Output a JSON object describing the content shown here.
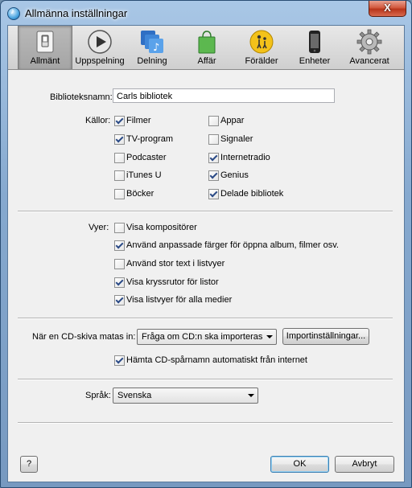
{
  "window": {
    "title": "Allmänna inställningar",
    "close_label": "X"
  },
  "toolbar": {
    "items": [
      {
        "label": "Allmänt",
        "icon": "general-switch-icon",
        "active": true
      },
      {
        "label": "Uppspelning",
        "icon": "play-icon"
      },
      {
        "label": "Delning",
        "icon": "sharing-icon"
      },
      {
        "label": "Affär",
        "icon": "store-bag-icon"
      },
      {
        "label": "Förälder",
        "icon": "parental-icon"
      },
      {
        "label": "Enheter",
        "icon": "device-icon"
      },
      {
        "label": "Avancerat",
        "icon": "gear-icon"
      }
    ]
  },
  "library": {
    "label": "Biblioteksnamn:",
    "value": "Carls bibliotek"
  },
  "sources": {
    "label": "Källor:",
    "items": [
      {
        "label": "Filmer",
        "checked": true
      },
      {
        "label": "TV-program",
        "checked": true
      },
      {
        "label": "Podcaster",
        "checked": false
      },
      {
        "label": "iTunes U",
        "checked": false
      },
      {
        "label": "Böcker",
        "checked": false
      },
      {
        "label": "Appar",
        "checked": false
      },
      {
        "label": "Signaler",
        "checked": false
      },
      {
        "label": "Internetradio",
        "checked": true
      },
      {
        "label": "Genius",
        "checked": true
      },
      {
        "label": "Delade bibliotek",
        "checked": true
      }
    ]
  },
  "views": {
    "label": "Vyer:",
    "items": [
      {
        "label": "Visa kompositörer",
        "checked": false
      },
      {
        "label": "Använd anpassade färger för öppna album, filmer osv.",
        "checked": true
      },
      {
        "label": "Använd stor text i listvyer",
        "checked": false
      },
      {
        "label": "Visa kryssrutor för listor",
        "checked": true
      },
      {
        "label": "Visa listvyer för alla medier",
        "checked": true
      }
    ]
  },
  "cd": {
    "label": "När en CD-skiva matas in:",
    "select_value": "Fråga om CD:n ska importeras",
    "import_button": "Importinställningar...",
    "fetch_label": "Hämta CD-spårnamn automatiskt från internet",
    "fetch_checked": true
  },
  "language": {
    "label": "Språk:",
    "value": "Svenska"
  },
  "footer": {
    "help": "?",
    "ok": "OK",
    "cancel": "Avbryt"
  }
}
